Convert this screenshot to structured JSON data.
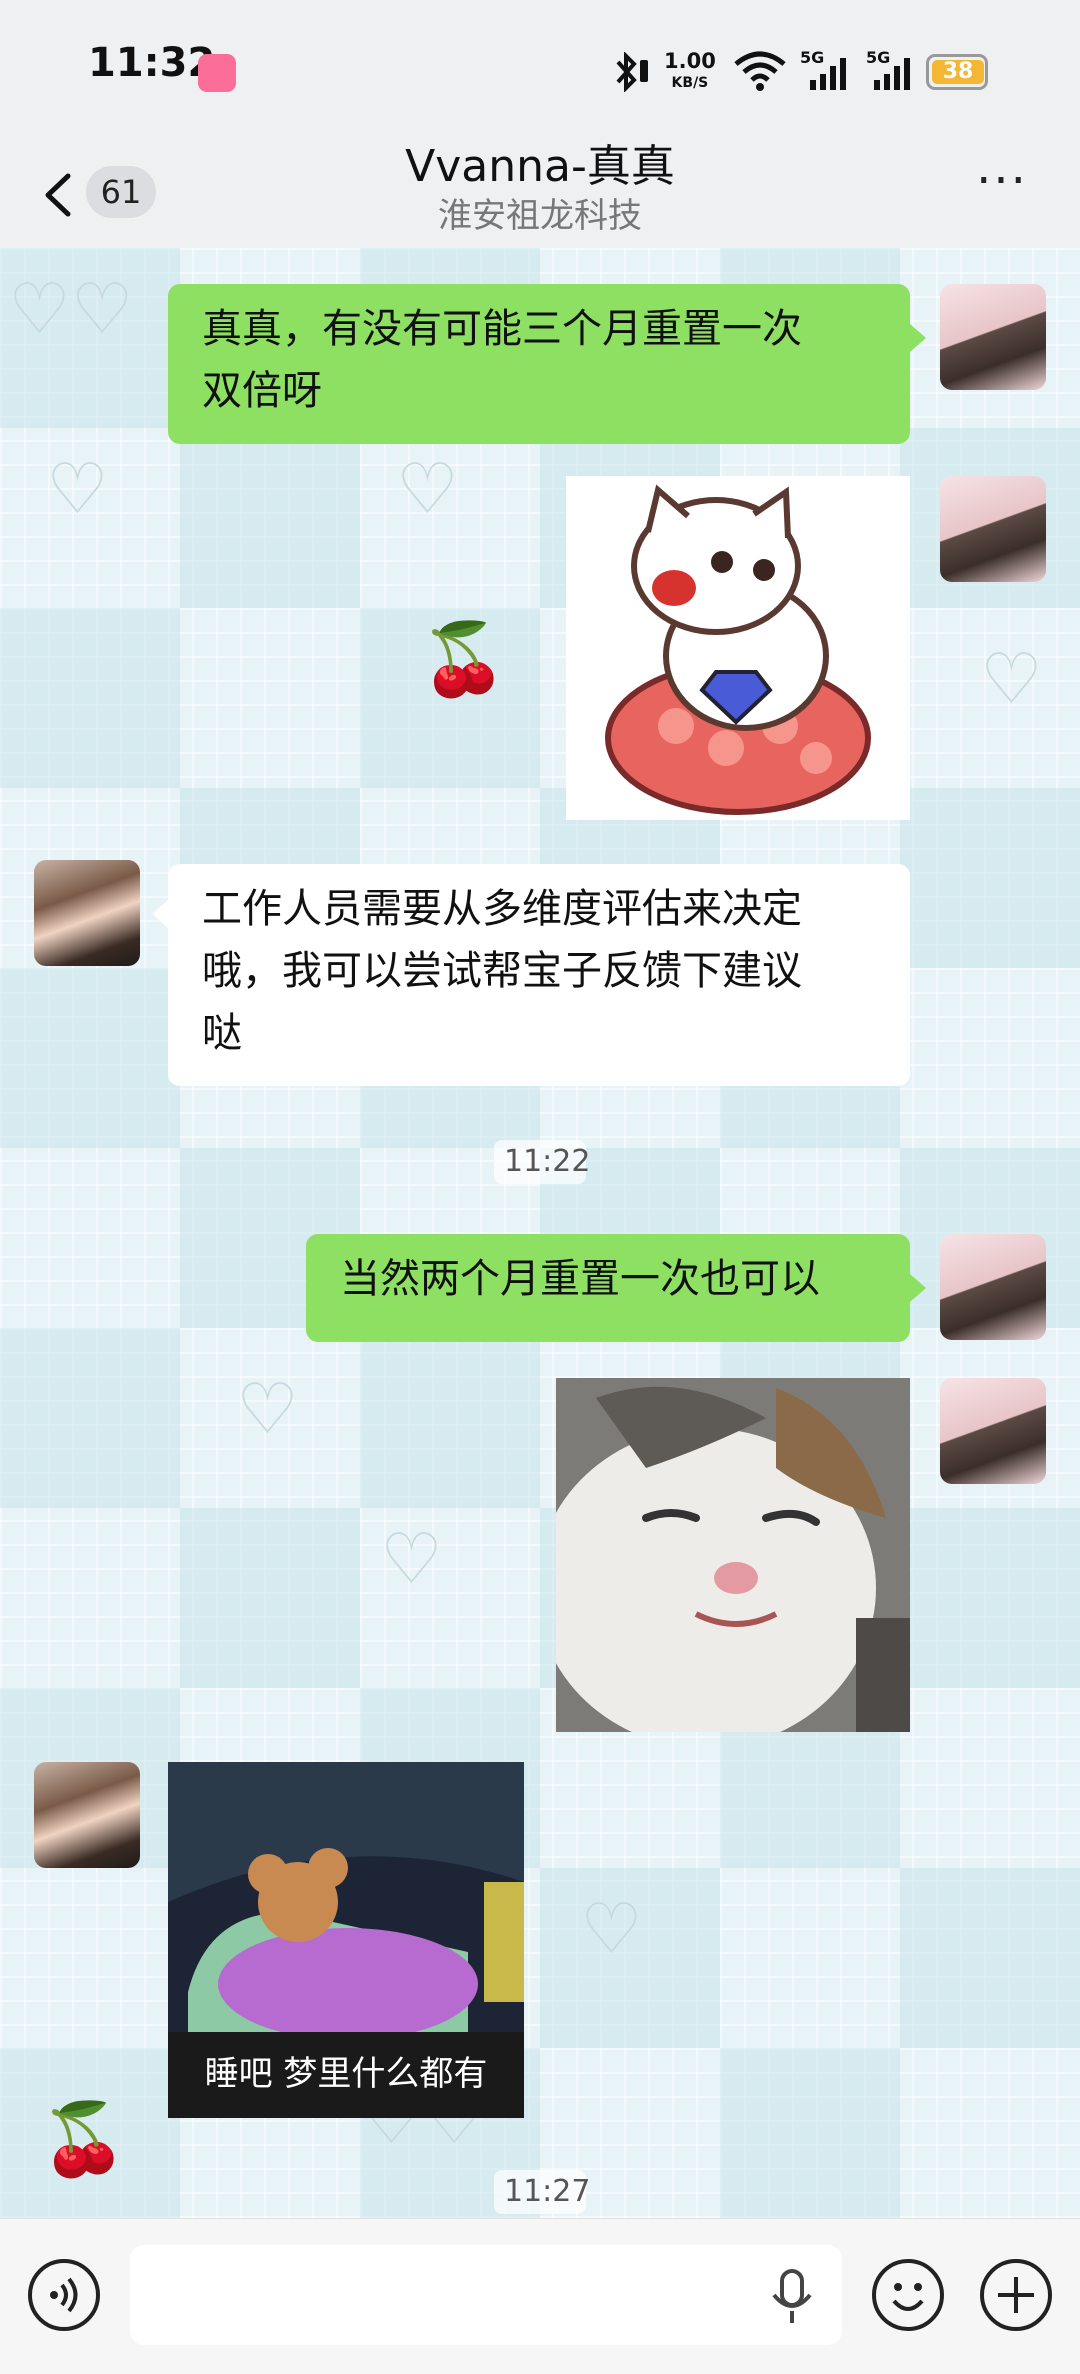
{
  "status_bar": {
    "time": "11:32",
    "net_speed_value": "1.00",
    "net_speed_unit": "KB/S",
    "signal1_label": "5G",
    "signal2_label": "5G",
    "battery_level": "38"
  },
  "header": {
    "unread_count": "61",
    "title": "Vvanna-真真",
    "subtitle": "淮安祖龙科技"
  },
  "messages": [
    {
      "sender": "me",
      "type": "text",
      "text_line1": "真真，有没有可能三个月重置一次",
      "text_line2": "双倍呀"
    },
    {
      "sender": "me",
      "type": "sticker",
      "sticker": "white-dog-sitting-on-red-cushion-with-diamond"
    },
    {
      "sender": "them",
      "type": "text",
      "text_line1": "工作人员需要从多维度评估来决定",
      "text_line2": "哦，我可以尝试帮宝子反馈下建议",
      "text_line3": "哒"
    },
    {
      "type": "timestamp",
      "text": "11:22"
    },
    {
      "sender": "me",
      "type": "text",
      "text_line1": "当然两个月重置一次也可以"
    },
    {
      "sender": "me",
      "type": "sticker",
      "sticker": "smiling-cat-photo"
    },
    {
      "sender": "them",
      "type": "sticker",
      "sticker": "sleeping-mouse-cartoon",
      "caption": "睡吧 梦里什么都有"
    },
    {
      "type": "timestamp",
      "text": "11:27"
    }
  ],
  "input_bar": {
    "placeholder": ""
  },
  "colors": {
    "outgoing_bubble": "#8ee063",
    "incoming_bubble": "#ffffff",
    "chat_background": "#e7f3f6"
  }
}
